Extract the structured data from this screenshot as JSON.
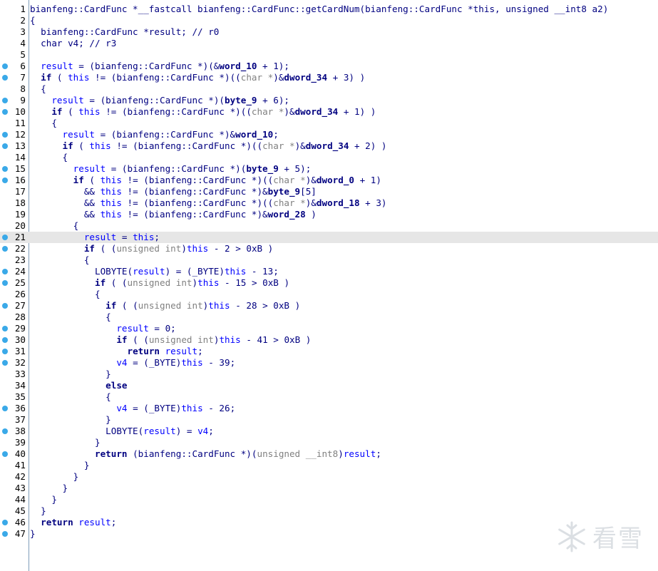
{
  "watermark": {
    "icon": "snowflake-icon",
    "text": "看雪"
  },
  "colors": {
    "breakpoint": "#3aa9e8",
    "highlight_line": "#e6e6e6",
    "type": "#000080",
    "keyword": "#000080",
    "cast_gray": "#808080",
    "variable": "#0000ff",
    "data_symbol": "#000080"
  },
  "highlighted_line": 21,
  "lines": [
    {
      "n": "1",
      "bp": false,
      "segs": [
        [
          "t",
          "bianfeng::CardFunc *__fastcall bianfeng::CardFunc::getCardNum(bianfeng::CardFunc *this, unsigned __int8 a2)"
        ]
      ]
    },
    {
      "n": "2",
      "bp": false,
      "segs": [
        [
          "t",
          "{"
        ]
      ]
    },
    {
      "n": "3",
      "bp": false,
      "segs": [
        [
          "t",
          "  bianfeng::CardFunc *result; // r0"
        ]
      ]
    },
    {
      "n": "4",
      "bp": false,
      "segs": [
        [
          "t",
          "  char v4; // r3"
        ]
      ]
    },
    {
      "n": "5",
      "bp": false,
      "segs": [
        [
          "t",
          ""
        ]
      ]
    },
    {
      "n": "6",
      "bp": true,
      "segs": [
        [
          "t",
          "  "
        ],
        [
          "v",
          "result"
        ],
        [
          "t",
          " = (bianfeng::CardFunc *)(&"
        ],
        [
          "d",
          "word_10"
        ],
        [
          "t",
          " + 1);"
        ]
      ]
    },
    {
      "n": "7",
      "bp": true,
      "segs": [
        [
          "t",
          "  "
        ],
        [
          "k",
          "if"
        ],
        [
          "t",
          " ( "
        ],
        [
          "v",
          "this"
        ],
        [
          "t",
          " != (bianfeng::CardFunc *)(("
        ],
        [
          "g",
          "char *"
        ],
        [
          "t",
          ")&"
        ],
        [
          "d",
          "dword_34"
        ],
        [
          "t",
          " + 3) )"
        ]
      ]
    },
    {
      "n": "8",
      "bp": false,
      "segs": [
        [
          "t",
          "  {"
        ]
      ]
    },
    {
      "n": "9",
      "bp": true,
      "segs": [
        [
          "t",
          "    "
        ],
        [
          "v",
          "result"
        ],
        [
          "t",
          " = (bianfeng::CardFunc *)("
        ],
        [
          "d",
          "byte_9"
        ],
        [
          "t",
          " + 6);"
        ]
      ]
    },
    {
      "n": "10",
      "bp": true,
      "segs": [
        [
          "t",
          "    "
        ],
        [
          "k",
          "if"
        ],
        [
          "t",
          " ( "
        ],
        [
          "v",
          "this"
        ],
        [
          "t",
          " != (bianfeng::CardFunc *)(("
        ],
        [
          "g",
          "char *"
        ],
        [
          "t",
          ")&"
        ],
        [
          "d",
          "dword_34"
        ],
        [
          "t",
          " + 1) )"
        ]
      ]
    },
    {
      "n": "11",
      "bp": false,
      "segs": [
        [
          "t",
          "    {"
        ]
      ]
    },
    {
      "n": "12",
      "bp": true,
      "segs": [
        [
          "t",
          "      "
        ],
        [
          "v",
          "result"
        ],
        [
          "t",
          " = (bianfeng::CardFunc *)&"
        ],
        [
          "d",
          "word_10"
        ],
        [
          "t",
          ";"
        ]
      ]
    },
    {
      "n": "13",
      "bp": true,
      "segs": [
        [
          "t",
          "      "
        ],
        [
          "k",
          "if"
        ],
        [
          "t",
          " ( "
        ],
        [
          "v",
          "this"
        ],
        [
          "t",
          " != (bianfeng::CardFunc *)(("
        ],
        [
          "g",
          "char *"
        ],
        [
          "t",
          ")&"
        ],
        [
          "d",
          "dword_34"
        ],
        [
          "t",
          " + 2) )"
        ]
      ]
    },
    {
      "n": "14",
      "bp": false,
      "segs": [
        [
          "t",
          "      {"
        ]
      ]
    },
    {
      "n": "15",
      "bp": true,
      "segs": [
        [
          "t",
          "        "
        ],
        [
          "v",
          "result"
        ],
        [
          "t",
          " = (bianfeng::CardFunc *)("
        ],
        [
          "d",
          "byte_9"
        ],
        [
          "t",
          " + 5);"
        ]
      ]
    },
    {
      "n": "16",
      "bp": true,
      "segs": [
        [
          "t",
          "        "
        ],
        [
          "k",
          "if"
        ],
        [
          "t",
          " ( "
        ],
        [
          "v",
          "this"
        ],
        [
          "t",
          " != (bianfeng::CardFunc *)(("
        ],
        [
          "g",
          "char *"
        ],
        [
          "t",
          ")&"
        ],
        [
          "d",
          "dword_0"
        ],
        [
          "t",
          " + 1)"
        ]
      ]
    },
    {
      "n": "17",
      "bp": false,
      "segs": [
        [
          "t",
          "          && "
        ],
        [
          "v",
          "this"
        ],
        [
          "t",
          " != (bianfeng::CardFunc *)&"
        ],
        [
          "d",
          "byte_9"
        ],
        [
          "t",
          "[5]"
        ]
      ]
    },
    {
      "n": "18",
      "bp": false,
      "segs": [
        [
          "t",
          "          && "
        ],
        [
          "v",
          "this"
        ],
        [
          "t",
          " != (bianfeng::CardFunc *)(("
        ],
        [
          "g",
          "char *"
        ],
        [
          "t",
          ")&"
        ],
        [
          "d",
          "dword_18"
        ],
        [
          "t",
          " + 3)"
        ]
      ]
    },
    {
      "n": "19",
      "bp": false,
      "segs": [
        [
          "t",
          "          && "
        ],
        [
          "v",
          "this"
        ],
        [
          "t",
          " != (bianfeng::CardFunc *)&"
        ],
        [
          "d",
          "word_28"
        ],
        [
          "t",
          " )"
        ]
      ]
    },
    {
      "n": "20",
      "bp": false,
      "segs": [
        [
          "t",
          "        {"
        ]
      ]
    },
    {
      "n": "21",
      "bp": true,
      "segs": [
        [
          "t",
          "          "
        ],
        [
          "v",
          "result"
        ],
        [
          "t",
          " = "
        ],
        [
          "v",
          "this"
        ],
        [
          "t",
          ";"
        ]
      ]
    },
    {
      "n": "22",
      "bp": true,
      "segs": [
        [
          "t",
          "          "
        ],
        [
          "k",
          "if"
        ],
        [
          "t",
          " ( ("
        ],
        [
          "g",
          "unsigned int"
        ],
        [
          "t",
          ")"
        ],
        [
          "v",
          "this"
        ],
        [
          "t",
          " - 2 > 0xB )"
        ]
      ]
    },
    {
      "n": "23",
      "bp": false,
      "segs": [
        [
          "t",
          "          {"
        ]
      ]
    },
    {
      "n": "24",
      "bp": true,
      "segs": [
        [
          "t",
          "            LOBYTE("
        ],
        [
          "v",
          "result"
        ],
        [
          "t",
          ") = (_BYTE)"
        ],
        [
          "v",
          "this"
        ],
        [
          "t",
          " - 13;"
        ]
      ]
    },
    {
      "n": "25",
      "bp": true,
      "segs": [
        [
          "t",
          "            "
        ],
        [
          "k",
          "if"
        ],
        [
          "t",
          " ( ("
        ],
        [
          "g",
          "unsigned int"
        ],
        [
          "t",
          ")"
        ],
        [
          "v",
          "this"
        ],
        [
          "t",
          " - 15 > 0xB )"
        ]
      ]
    },
    {
      "n": "26",
      "bp": false,
      "segs": [
        [
          "t",
          "            {"
        ]
      ]
    },
    {
      "n": "27",
      "bp": true,
      "segs": [
        [
          "t",
          "              "
        ],
        [
          "k",
          "if"
        ],
        [
          "t",
          " ( ("
        ],
        [
          "g",
          "unsigned int"
        ],
        [
          "t",
          ")"
        ],
        [
          "v",
          "this"
        ],
        [
          "t",
          " - 28 > 0xB )"
        ]
      ]
    },
    {
      "n": "28",
      "bp": false,
      "segs": [
        [
          "t",
          "              {"
        ]
      ]
    },
    {
      "n": "29",
      "bp": true,
      "segs": [
        [
          "t",
          "                "
        ],
        [
          "v",
          "result"
        ],
        [
          "t",
          " = 0;"
        ]
      ]
    },
    {
      "n": "30",
      "bp": true,
      "segs": [
        [
          "t",
          "                "
        ],
        [
          "k",
          "if"
        ],
        [
          "t",
          " ( ("
        ],
        [
          "g",
          "unsigned int"
        ],
        [
          "t",
          ")"
        ],
        [
          "v",
          "this"
        ],
        [
          "t",
          " - 41 > 0xB )"
        ]
      ]
    },
    {
      "n": "31",
      "bp": true,
      "segs": [
        [
          "t",
          "                  "
        ],
        [
          "k",
          "return"
        ],
        [
          "t",
          " "
        ],
        [
          "v",
          "result"
        ],
        [
          "t",
          ";"
        ]
      ]
    },
    {
      "n": "32",
      "bp": true,
      "segs": [
        [
          "t",
          "                "
        ],
        [
          "v",
          "v4"
        ],
        [
          "t",
          " = (_BYTE)"
        ],
        [
          "v",
          "this"
        ],
        [
          "t",
          " - 39;"
        ]
      ]
    },
    {
      "n": "33",
      "bp": false,
      "segs": [
        [
          "t",
          "              }"
        ]
      ]
    },
    {
      "n": "34",
      "bp": false,
      "segs": [
        [
          "t",
          "              "
        ],
        [
          "k",
          "else"
        ]
      ]
    },
    {
      "n": "35",
      "bp": false,
      "segs": [
        [
          "t",
          "              {"
        ]
      ]
    },
    {
      "n": "36",
      "bp": true,
      "segs": [
        [
          "t",
          "                "
        ],
        [
          "v",
          "v4"
        ],
        [
          "t",
          " = (_BYTE)"
        ],
        [
          "v",
          "this"
        ],
        [
          "t",
          " - 26;"
        ]
      ]
    },
    {
      "n": "37",
      "bp": false,
      "segs": [
        [
          "t",
          "              }"
        ]
      ]
    },
    {
      "n": "38",
      "bp": true,
      "segs": [
        [
          "t",
          "              LOBYTE("
        ],
        [
          "v",
          "result"
        ],
        [
          "t",
          ") = "
        ],
        [
          "v",
          "v4"
        ],
        [
          "t",
          ";"
        ]
      ]
    },
    {
      "n": "39",
      "bp": false,
      "segs": [
        [
          "t",
          "            }"
        ]
      ]
    },
    {
      "n": "40",
      "bp": true,
      "segs": [
        [
          "t",
          "            "
        ],
        [
          "k",
          "return"
        ],
        [
          "t",
          " (bianfeng::CardFunc *)("
        ],
        [
          "g",
          "unsigned __int8"
        ],
        [
          "t",
          ")"
        ],
        [
          "v",
          "result"
        ],
        [
          "t",
          ";"
        ]
      ]
    },
    {
      "n": "41",
      "bp": false,
      "segs": [
        [
          "t",
          "          }"
        ]
      ]
    },
    {
      "n": "42",
      "bp": false,
      "segs": [
        [
          "t",
          "        }"
        ]
      ]
    },
    {
      "n": "43",
      "bp": false,
      "segs": [
        [
          "t",
          "      }"
        ]
      ]
    },
    {
      "n": "44",
      "bp": false,
      "segs": [
        [
          "t",
          "    }"
        ]
      ]
    },
    {
      "n": "45",
      "bp": false,
      "segs": [
        [
          "t",
          "  }"
        ]
      ]
    },
    {
      "n": "46",
      "bp": true,
      "segs": [
        [
          "t",
          "  "
        ],
        [
          "k",
          "return"
        ],
        [
          "t",
          " "
        ],
        [
          "v",
          "result"
        ],
        [
          "t",
          ";"
        ]
      ]
    },
    {
      "n": "47",
      "bp": true,
      "segs": [
        [
          "t",
          "}"
        ]
      ]
    }
  ]
}
